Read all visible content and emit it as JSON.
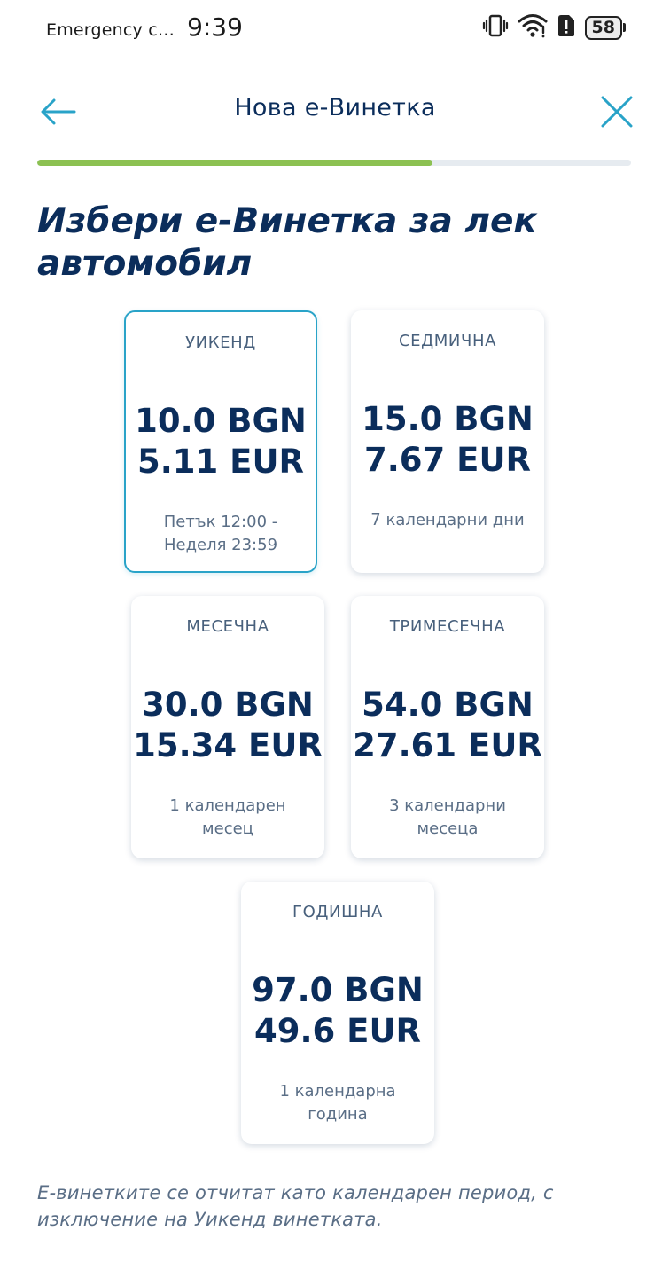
{
  "status_bar": {
    "carrier": "Emergency c…",
    "time": "9:39",
    "battery": "58"
  },
  "header": {
    "title": "Нова е-Винетка"
  },
  "progress": {
    "fraction": 0.665,
    "color": "#8cc152"
  },
  "heading": "Избери е-Винетка за лек автомобил",
  "cards": [
    {
      "name": "УИКЕНД",
      "price_bgn": "10.0 BGN",
      "price_eur": "5.11 EUR",
      "description": "Петък 12:00 - Неделя 23:59",
      "selected": true
    },
    {
      "name": "СЕДМИЧНА",
      "price_bgn": "15.0 BGN",
      "price_eur": "7.67 EUR",
      "description": "7 календарни дни",
      "selected": false
    },
    {
      "name": "МЕСЕЧНА",
      "price_bgn": "30.0 BGN",
      "price_eur": "15.34 EUR",
      "description": "1 календарен месец",
      "selected": false
    },
    {
      "name": "ТРИМЕСЕЧНА",
      "price_bgn": "54.0 BGN",
      "price_eur": "27.61 EUR",
      "description": "3 календарни месеца",
      "selected": false
    },
    {
      "name": "ГОДИШНА",
      "price_bgn": "97.0 BGN",
      "price_eur": "49.6 EUR",
      "description": "1 календарна година",
      "selected": false
    }
  ],
  "footer_note": "Е-винетките се отчитат като календарен период, с изключение на Уикенд винетката.",
  "colors": {
    "primary_text": "#0b2d5b",
    "accent": "#29a3c8",
    "progress": "#8cc152"
  }
}
